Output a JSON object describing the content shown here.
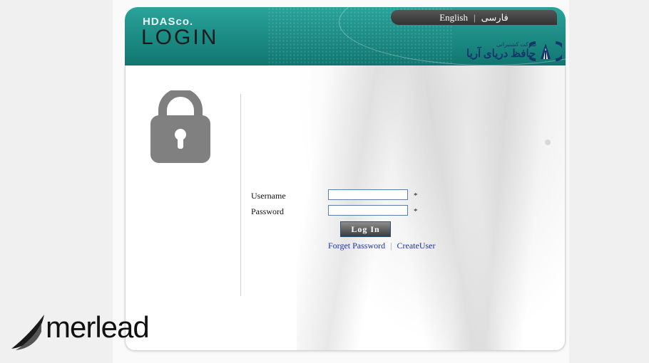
{
  "header": {
    "brand_small": "HDASco.",
    "brand_big": "LOGIN",
    "logo_text_small": "شرکت کشتیرانی",
    "logo_text_big": "حافظ دریای آریا"
  },
  "language": {
    "english": "English",
    "separator": "|",
    "farsi": "فارسی"
  },
  "form": {
    "username_label": "Username",
    "password_label": "Password",
    "required_mark": "*",
    "username_value": "",
    "password_value": "",
    "login_button": "Log In",
    "forget_password": "Forget Password",
    "link_separator": "|",
    "create_user": "CreateUser"
  },
  "watermark": {
    "text": "merlead"
  },
  "colors": {
    "header_teal": "#1b8a83",
    "link_blue": "#1a30a8",
    "input_border": "#5a7fa8"
  }
}
